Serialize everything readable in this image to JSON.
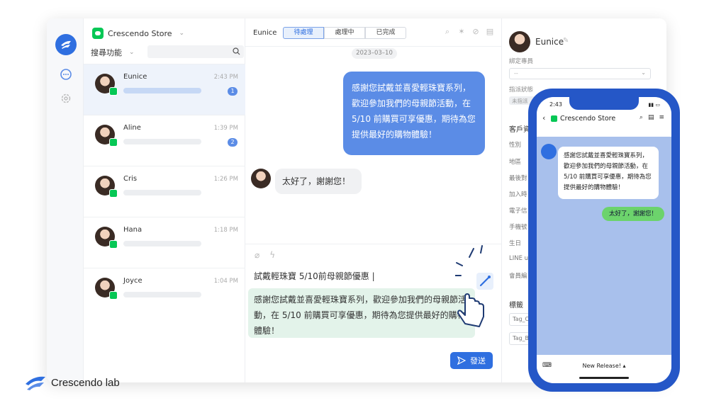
{
  "app": {
    "store_name": "Crescendo Store",
    "search_label": "搜尋功能"
  },
  "conversations": [
    {
      "name": "Eunice",
      "time": "2:43 PM",
      "unread": "1"
    },
    {
      "name": "Aline",
      "time": "1:39 PM",
      "unread": "2"
    },
    {
      "name": "Cris",
      "time": "1:26 PM",
      "unread": ""
    },
    {
      "name": "Hana",
      "time": "1:18 PM",
      "unread": ""
    },
    {
      "name": "Joyce",
      "time": "1:04 PM",
      "unread": ""
    }
  ],
  "chat": {
    "user": "Eunice",
    "tabs": [
      "待處理",
      "處理中",
      "已完成"
    ],
    "date": "2023–03–10",
    "outgoing_message": "感謝您試戴並喜愛輕珠寶系列，歡迎參加我們的母親節活動，在 5/10 前購買可享優惠，期待為您提供最好的購物體驗！",
    "incoming_message": "太好了，謝謝您！",
    "composer_input": "試戴輕珠寶 5/10前母親節優惠 |",
    "suggestion": "感謝您試戴並喜愛輕珠寶系列，歡迎參加我們的母親節活動，在 5/10 前購買可享優惠，期待為您提供最好的購物體驗！",
    "send_label": "發送"
  },
  "profile": {
    "name": "Eunice",
    "assigned_label": "綁定專員",
    "assigned_value": "--",
    "status_label": "指派狀態",
    "status_value": "未指派",
    "section_title": "客戶資",
    "fields": [
      "性別",
      "地區",
      "最後對",
      "加入時",
      "電子信",
      "手機號",
      "生日",
      "LINE u",
      "會員編"
    ],
    "tags_title": "標籤",
    "tags": [
      "Tag_C",
      "Tag_B"
    ]
  },
  "phone": {
    "time": "2:43",
    "store_name": "Crescendo Store",
    "incoming": "感謝您試戴並喜愛輕珠寶系列，歡迎參加我們的母親節活動，在 5/10 前購買可享優惠，期待為您提供最好的購物體驗！",
    "outgoing": "太好了，謝謝您！",
    "footer": "New Release! ▴"
  },
  "brand": {
    "name_main": "Crescendo",
    "name_suffix": "lab"
  },
  "colors": {
    "accent": "#2f6fe0",
    "bubble_out": "#5b8ce6",
    "line_green": "#06c755",
    "suggestion_bg": "#e3f3ea",
    "phone_frame": "#2557c7"
  }
}
